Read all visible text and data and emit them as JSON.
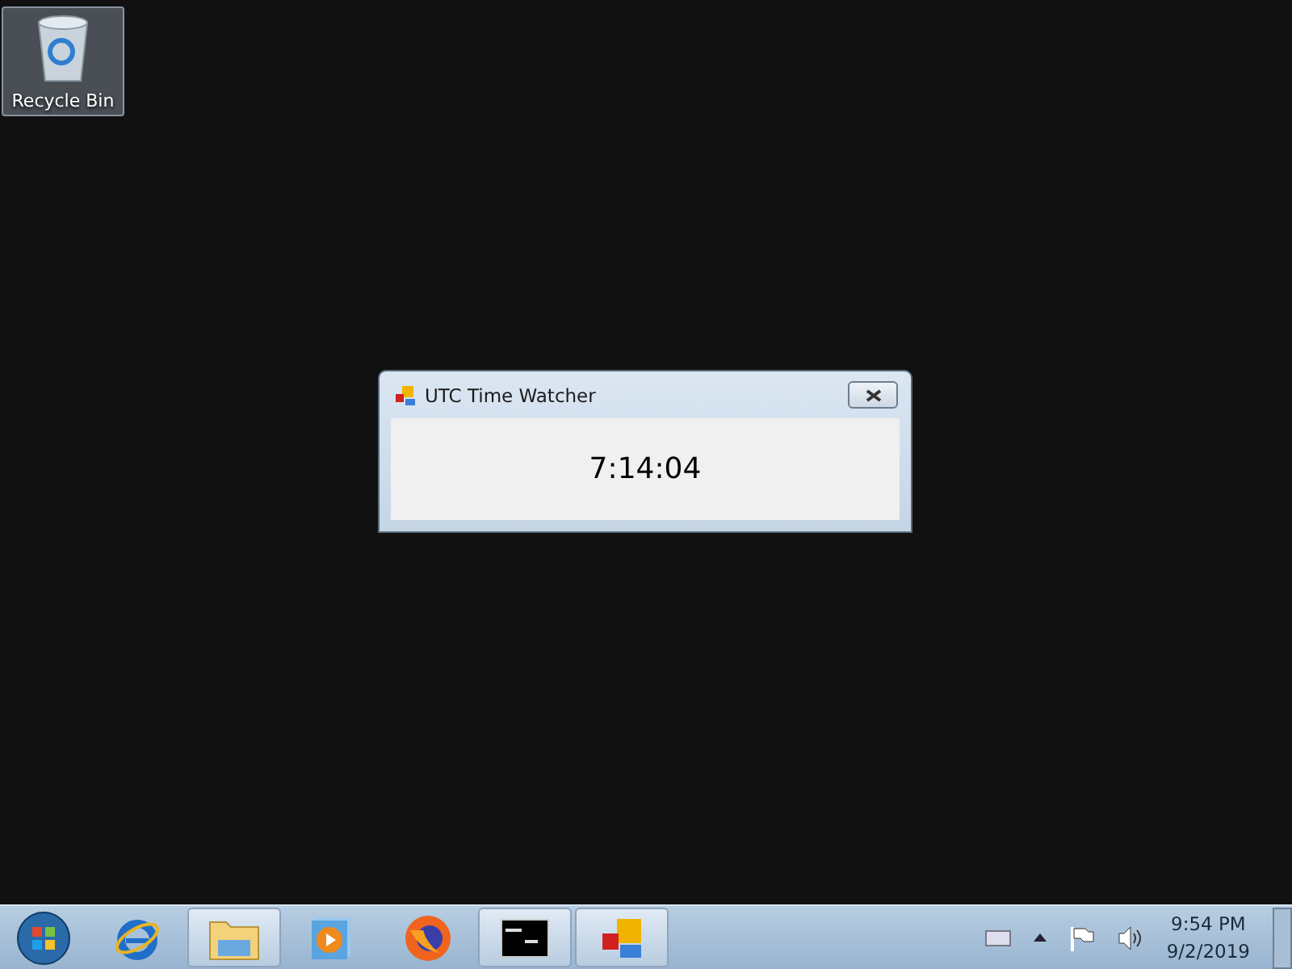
{
  "desktop_icons": [
    {
      "label": "Recycle Bin",
      "kind": "recycle-bin",
      "selected": true
    }
  ],
  "window": {
    "title": "UTC Time Watcher",
    "time": "7:14:04"
  },
  "taskbar": {
    "items": [
      {
        "kind": "start",
        "open": false
      },
      {
        "kind": "browser-e",
        "open": false
      },
      {
        "kind": "folder",
        "open": true
      },
      {
        "kind": "media",
        "open": false
      },
      {
        "kind": "fox",
        "open": false
      },
      {
        "kind": "console",
        "open": true
      },
      {
        "kind": "app",
        "open": true
      }
    ],
    "tray_time": "9:54 PM",
    "tray_date": "9/2/2019"
  }
}
